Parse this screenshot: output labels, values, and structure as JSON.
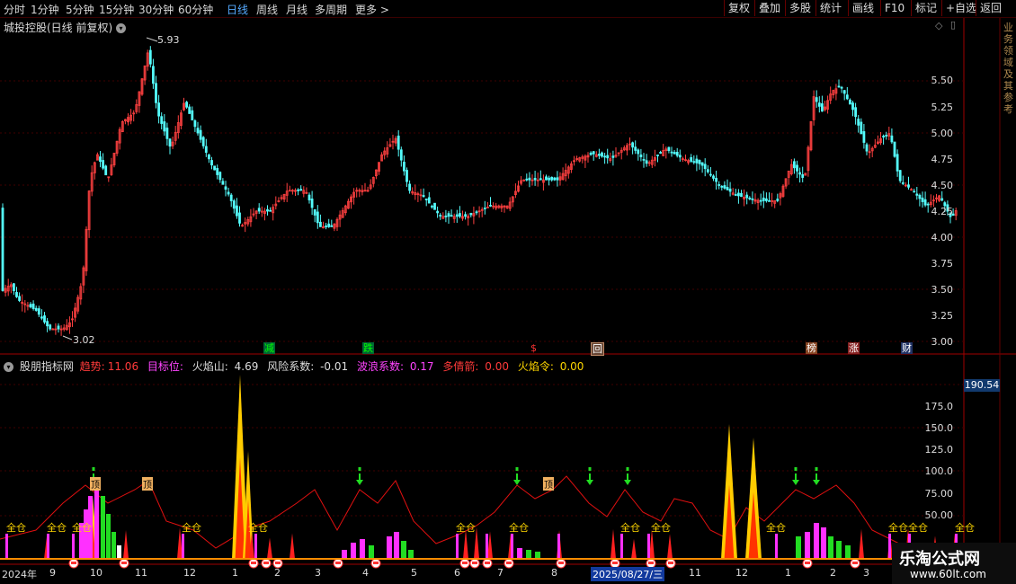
{
  "toolbar": {
    "periods": [
      "分时",
      "1分钟",
      "5分钟",
      "15分钟",
      "30分钟",
      "60分钟",
      "日线",
      "周线",
      "月线",
      "多周期",
      "更多 >"
    ],
    "active_period": "日线",
    "right_buttons": [
      "复权",
      "叠加",
      "多股",
      "统计",
      "画线",
      "F10",
      "标记",
      "+自选",
      "返回"
    ]
  },
  "price_panel": {
    "title": "城投控股(日线 前复权)",
    "high_label": "5.93",
    "low_label": "3.02",
    "y_ticks": [
      "5.50",
      "5.25",
      "5.00",
      "4.75",
      "4.50",
      "4.25",
      "4.00",
      "3.75",
      "3.50",
      "3.25",
      "3.00"
    ],
    "event_markers": [
      "减",
      "跌",
      "$",
      "回",
      "榜",
      "涨",
      "财"
    ]
  },
  "indicator_panel": {
    "name": "股朋指标网",
    "values": [
      {
        "label": "趋势:",
        "value": "11.06",
        "color": "#ff3a3a"
      },
      {
        "label": "目标位:",
        "value": "",
        "color": "#ff44ff"
      },
      {
        "label": "火焰山:",
        "value": "4.69",
        "color": "#dddddd"
      },
      {
        "label": "风险系数:",
        "value": "-0.01",
        "color": "#dddddd"
      },
      {
        "label": "波浪系数:",
        "value": "0.17",
        "color": "#ff44ff"
      },
      {
        "label": "多倩箭:",
        "value": "0.00",
        "color": "#ff3a3a"
      },
      {
        "label": "火焰令:",
        "value": "0.00",
        "color": "#ffd700"
      }
    ],
    "current_value": "190.54",
    "y_ticks": [
      "175.0",
      "150.0",
      "125.0",
      "100.0",
      "75.00",
      "50.00"
    ],
    "signal_text": "全仓",
    "ding_text": "顶"
  },
  "dates": [
    "2024年",
    "9",
    "10",
    "11",
    "12",
    "1",
    "2",
    "3",
    "4",
    "5",
    "6",
    "7",
    "8",
    "2025/08/27/三",
    "11",
    "12",
    "1",
    "2",
    "3"
  ],
  "watermark": {
    "brand": "乐淘公式网",
    "url": "www.60lt.com"
  },
  "side_text": "业务领域及其参考"
}
